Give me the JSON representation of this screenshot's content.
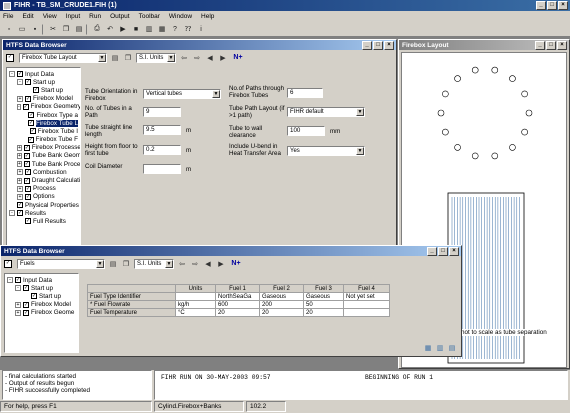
{
  "app": {
    "title": "FIHR - TB_SM_CRUDE1.FIH (1)"
  },
  "menu": [
    "File",
    "Edit",
    "View",
    "Input",
    "Run",
    "Output",
    "Toolbar",
    "Window",
    "Help"
  ],
  "toolbar_icons": [
    "new-icon",
    "open-icon",
    "save-icon",
    "print-icon",
    "cut-icon",
    "copy-icon",
    "paste-icon",
    "undo-icon",
    "run-icon",
    "stop-icon",
    "chart-icon",
    "table-icon",
    "help-icon"
  ],
  "browser1": {
    "title": "HTFS Data Browser",
    "page": "Firebox Tube Layout",
    "units": "S.I. Units",
    "nav_next": "N+",
    "tree": [
      {
        "label": "Input Data",
        "level": 0,
        "exp": "-",
        "chk": true
      },
      {
        "label": "Start up",
        "level": 1,
        "exp": "-",
        "chk": true
      },
      {
        "label": "Start up",
        "level": 2,
        "exp": "",
        "chk": true
      },
      {
        "label": "Firebox Model",
        "level": 1,
        "exp": "+",
        "chk": true
      },
      {
        "label": "Firebox Geometry",
        "level": 1,
        "exp": "-",
        "chk": true
      },
      {
        "label": "Firebox Type a",
        "level": 2,
        "exp": "",
        "chk": true
      },
      {
        "label": "Firebox Tube L",
        "level": 2,
        "exp": "",
        "chk": true,
        "selected": true
      },
      {
        "label": "Firebox Tube I",
        "level": 2,
        "exp": "",
        "chk": true
      },
      {
        "label": "Firebox Tube F",
        "level": 2,
        "exp": "",
        "chk": true
      },
      {
        "label": "Firebox Processes",
        "level": 1,
        "exp": "+",
        "chk": true
      },
      {
        "label": "Tube Bank Geome",
        "level": 1,
        "exp": "+",
        "chk": true
      },
      {
        "label": "Tube Bank Proces",
        "level": 1,
        "exp": "+",
        "chk": true
      },
      {
        "label": "Combustion",
        "level": 1,
        "exp": "+",
        "chk": true
      },
      {
        "label": "Draught Calculatio",
        "level": 1,
        "exp": "+",
        "chk": true
      },
      {
        "label": "Process",
        "level": 1,
        "exp": "+",
        "chk": true
      },
      {
        "label": "Options",
        "level": 1,
        "exp": "+",
        "chk": true
      },
      {
        "label": "Physical Properties",
        "level": 1,
        "exp": "",
        "chk": true
      },
      {
        "label": "Results",
        "level": 0,
        "exp": "-",
        "chk": true
      },
      {
        "label": "Full Results",
        "level": 1,
        "exp": "",
        "chk": true
      }
    ],
    "fields": {
      "tube_orientation_label": "Tube Orientation in Firebox",
      "tube_orientation_value": "Vertical tubes",
      "tubes_in_path_label": "No. of Tubes in a Path",
      "tubes_in_path_value": "9",
      "straight_len_label": "Tube straight line length",
      "straight_len_value": "9.5",
      "straight_len_unit": "m",
      "height_label": "Height from floor to first tube",
      "height_value": "0.2",
      "height_unit": "m",
      "coil_label": "Coil Diameter",
      "coil_value": "",
      "coil_unit": "m",
      "paths_label": "No.of Paths through Firebox Tubes",
      "paths_value": "6",
      "path_layout_label": "Tube Path Layout (if >1 path)",
      "path_layout_value": "FIHR default",
      "wall_clear_label": "Tube to wall clearance",
      "wall_clear_value": "100",
      "wall_clear_unit": "mm",
      "ubend_label": "Include U-bend in Heat Transfer Area",
      "ubend_value": "Yes"
    }
  },
  "layout_win": {
    "title": "Firebox Layout",
    "note": "not to scale as tube separation"
  },
  "browser2": {
    "title": "HTFS Data Browser",
    "page": "Fuels",
    "units": "S.I. Units",
    "nav_next": "N+",
    "tree": [
      {
        "label": "Input Data",
        "level": 0,
        "exp": "-",
        "chk": true
      },
      {
        "label": "Start up",
        "level": 1,
        "exp": "-",
        "chk": true
      },
      {
        "label": "Start up",
        "level": 2,
        "exp": "",
        "chk": true
      },
      {
        "label": "Firebox Model",
        "level": 1,
        "exp": "+",
        "chk": true
      },
      {
        "label": "Firebox Geome",
        "level": 1,
        "exp": "+",
        "chk": true
      }
    ],
    "table": {
      "headers": [
        "",
        "Units",
        "Fuel 1",
        "Fuel 2",
        "Fuel 3",
        "Fuel 4"
      ],
      "rows": [
        [
          "Fuel Type Identifier",
          "",
          "NorthSeaGa",
          "Gaseous",
          "Gaseous",
          "Not yet set"
        ],
        [
          "* Fuel Flowrate",
          "kg/h",
          "600",
          "200",
          "50",
          ""
        ],
        [
          "Fuel Temperature",
          "°C",
          "20",
          "20",
          "20",
          ""
        ]
      ]
    }
  },
  "output_left": [
    "- final calculations started",
    "- Output of results begun",
    "- FIHR successfully completed"
  ],
  "output_right": {
    "text": "FIHR RUN ON 30-MAY-2003 09:57",
    "right": "BEGINNING OF RUN  1"
  },
  "status": {
    "help": "For help, press F1",
    "model": "Cylind.Firebox+Banks",
    "value": "102.2"
  }
}
